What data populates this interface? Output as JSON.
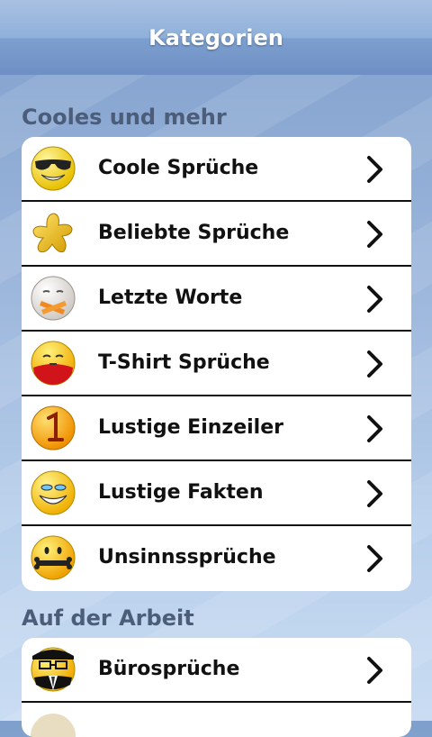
{
  "header": {
    "title": "Kategorien"
  },
  "sections": [
    {
      "title": "Cooles und mehr",
      "items": [
        {
          "label": "Coole Sprüche",
          "icon": "cool-sunglasses-smiley-icon"
        },
        {
          "label": "Beliebte Sprüche",
          "icon": "gold-star-icon"
        },
        {
          "label": "Letzte Worte",
          "icon": "taped-mouth-smiley-icon"
        },
        {
          "label": "T-Shirt Sprüche",
          "icon": "tshirt-smiley-icon"
        },
        {
          "label": "Lustige Einzeiler",
          "icon": "number-one-icon"
        },
        {
          "label": "Lustige Fakten",
          "icon": "laughing-smiley-icon"
        },
        {
          "label": "Unsinnssprüche",
          "icon": "bone-mouth-smiley-icon"
        }
      ]
    },
    {
      "title": "Auf der Arbeit",
      "items": [
        {
          "label": "Bürosprüche",
          "icon": "office-smiley-icon"
        }
      ]
    }
  ],
  "colors": {
    "header_text": "#ffffff",
    "section_text": "#4c5d79",
    "smiley": "#f5c000"
  }
}
